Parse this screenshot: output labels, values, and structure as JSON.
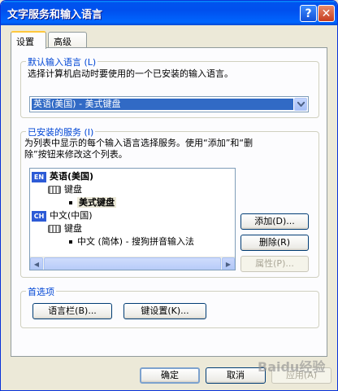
{
  "window": {
    "title": "文字服务和输入语言",
    "help_label": "?",
    "close_label": "✕"
  },
  "tabs": [
    {
      "label": "设置"
    },
    {
      "label": "高级"
    }
  ],
  "default_lang": {
    "group_title": "默认输入语言 (L)",
    "description": "选择计算机启动时要使用的一个已安装的输入语言。",
    "selected": "英语(美国) - 美式键盘"
  },
  "installed": {
    "group_title": "已安装的服务 (I)",
    "description_1": "为列表中显示的每个输入语言选择服务。使用“添加”和“删",
    "description_2": "除”按钮来修改这个列表。",
    "tree": [
      {
        "badge": "EN",
        "label": "英语(美国)"
      },
      {
        "label": "键盘"
      },
      {
        "label": "美式键盘"
      },
      {
        "badge": "CH",
        "label": "中文(中国)"
      },
      {
        "label": "键盘"
      },
      {
        "label": "中文 (简体) - 搜狗拼音输入法"
      }
    ],
    "add_label": "添加(D)...",
    "remove_label": "删除(R)",
    "properties_label": "属性(P)..."
  },
  "preferences": {
    "group_title": "首选项",
    "langbar_label": "语言栏(B)...",
    "keysettings_label": "键设置(K)..."
  },
  "footer": {
    "ok_label": "确定",
    "cancel_label": "取消",
    "apply_label": "应用(A)"
  },
  "watermark": "Baidu经验"
}
